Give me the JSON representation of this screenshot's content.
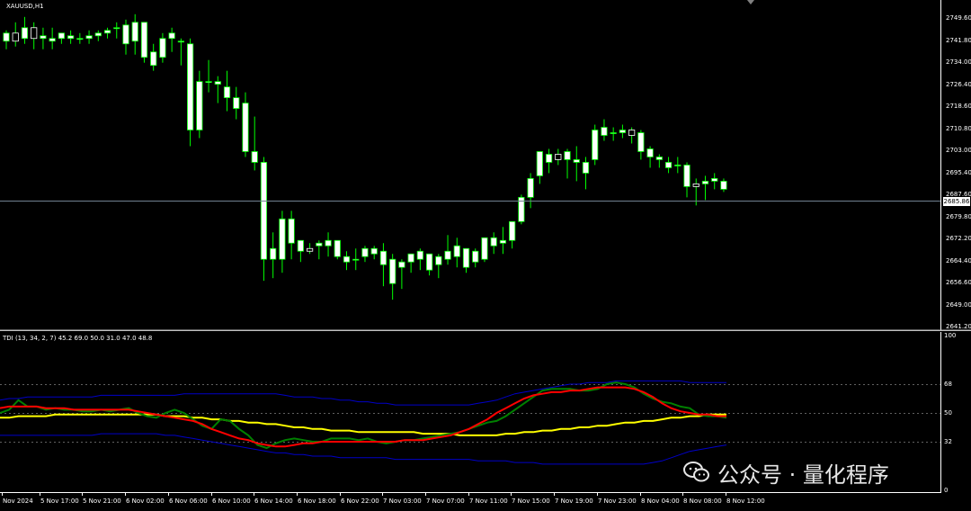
{
  "chart": {
    "symbol_title": "XAUUSD,H1",
    "indicator_title": "TDI (13, 34, 2, 7) 45.2 69.0 50.0 31.0 47.0 48.8",
    "current_price": "2685.86",
    "watermark": "公众号 · 量化程序",
    "colors": {
      "background": "#000000",
      "bull_candle": "#ffffff",
      "wick": "#00ff00",
      "price_line": "#708090",
      "rsi_line": "#008000",
      "signal_line": "#ff0000",
      "band_lines": "#0000c8",
      "base_line": "#ffff00"
    }
  },
  "price_axis": {
    "ticks": [
      "2749.60",
      "2741.80",
      "2734.00",
      "2726.40",
      "2718.60",
      "2710.80",
      "2703.00",
      "2695.40",
      "2687.60",
      "2679.80",
      "2672.20",
      "2664.40",
      "2656.60",
      "2649.00",
      "2641.20"
    ]
  },
  "tdi_axis": {
    "ticks": [
      "100",
      "68",
      "50",
      "32",
      "0"
    ]
  },
  "time_axis": {
    "ticks": [
      "Nov 2024",
      "5 Nov 17:00",
      "5 Nov 21:00",
      "6 Nov 02:00",
      "6 Nov 06:00",
      "6 Nov 10:00",
      "6 Nov 14:00",
      "6 Nov 18:00",
      "6 Nov 22:00",
      "7 Nov 03:00",
      "7 Nov 07:00",
      "7 Nov 11:00",
      "7 Nov 15:00",
      "7 Nov 19:00",
      "7 Nov 23:00",
      "8 Nov 04:00",
      "8 Nov 08:00",
      "8 Nov 12:00"
    ]
  },
  "candles": [
    [
      2741,
      2745,
      2738,
      2744
    ],
    [
      2744,
      2748,
      2739,
      2741
    ],
    [
      2742,
      2750,
      2740,
      2746
    ],
    [
      2746,
      2748,
      2738,
      2742
    ],
    [
      2742,
      2746,
      2738,
      2743
    ],
    [
      2741,
      2746,
      2738,
      2742
    ],
    [
      2742,
      2744,
      2740,
      2744
    ],
    [
      2742,
      2745,
      2740,
      2743
    ],
    [
      2742,
      2744,
      2740,
      2742
    ],
    [
      2742,
      2745,
      2740,
      2743
    ],
    [
      2743,
      2745,
      2741,
      2744
    ],
    [
      2744,
      2746,
      2742,
      2745
    ],
    [
      2746,
      2748,
      2742,
      2746
    ],
    [
      2740,
      2749,
      2736,
      2747
    ],
    [
      2741,
      2751,
      2736,
      2748
    ],
    [
      2735,
      2745,
      2733,
      2748
    ],
    [
      2732,
      2740,
      2730,
      2737
    ],
    [
      2735,
      2744,
      2733,
      2742
    ],
    [
      2742,
      2746,
      2737,
      2744
    ],
    [
      2741,
      2742,
      2732,
      2741
    ],
    [
      2708,
      2742,
      2702,
      2740
    ],
    [
      2708,
      2730,
      2705,
      2726
    ],
    [
      2726,
      2734,
      2722,
      2726
    ],
    [
      2725,
      2728,
      2718,
      2726
    ],
    [
      2720,
      2730,
      2715,
      2724
    ],
    [
      2716,
      2724,
      2712,
      2720
    ],
    [
      2700,
      2722,
      2698,
      2718
    ],
    [
      2696,
      2713,
      2693,
      2700
    ],
    [
      2660,
      2698,
      2652,
      2696
    ],
    [
      2660,
      2670,
      2653,
      2664
    ],
    [
      2660,
      2678,
      2655,
      2675
    ],
    [
      2666,
      2678,
      2660,
      2675
    ],
    [
      2663,
      2667,
      2659,
      2667
    ],
    [
      2664,
      2666,
      2662,
      2663
    ],
    [
      2665,
      2667,
      2660,
      2666
    ],
    [
      2665,
      2670,
      2661,
      2667
    ],
    [
      2661,
      2667,
      2660,
      2667
    ],
    [
      2659,
      2663,
      2656,
      2661
    ],
    [
      2660,
      2664,
      2656,
      2660
    ],
    [
      2661,
      2665,
      2659,
      2664
    ],
    [
      2662,
      2665,
      2660,
      2664
    ],
    [
      2658,
      2666,
      2650,
      2663
    ],
    [
      2651,
      2662,
      2645,
      2660
    ],
    [
      2657,
      2660,
      2649,
      2659
    ],
    [
      2659,
      2662,
      2655,
      2662
    ],
    [
      2660,
      2664,
      2656,
      2663
    ],
    [
      2656,
      2661,
      2654,
      2662
    ],
    [
      2658,
      2662,
      2653,
      2661
    ],
    [
      2660,
      2669,
      2658,
      2663
    ],
    [
      2661,
      2668,
      2657,
      2665
    ],
    [
      2657,
      2664,
      2655,
      2664
    ],
    [
      2659,
      2664,
      2657,
      2663
    ],
    [
      2660,
      2668,
      2659,
      2668
    ],
    [
      2665,
      2670,
      2662,
      2668
    ],
    [
      2666,
      2672,
      2662,
      2667
    ],
    [
      2667,
      2674,
      2664,
      2674
    ],
    [
      2674,
      2684,
      2673,
      2683
    ],
    [
      2683,
      2692,
      2679,
      2690
    ],
    [
      2691,
      2700,
      2688,
      2700
    ],
    [
      2696,
      2701,
      2692,
      2699
    ],
    [
      2699,
      2701,
      2695,
      2697
    ],
    [
      2697,
      2701,
      2690,
      2700
    ],
    [
      2696,
      2702,
      2689,
      2697
    ],
    [
      2692,
      2698,
      2686,
      2696
    ],
    [
      2697,
      2710,
      2695,
      2708
    ],
    [
      2706,
      2712,
      2704,
      2709
    ],
    [
      2707,
      2709,
      2704,
      2707
    ],
    [
      2707,
      2710,
      2705,
      2708
    ],
    [
      2708,
      2709,
      2703,
      2706
    ],
    [
      2700,
      2708,
      2697,
      2707
    ],
    [
      2698,
      2702,
      2694,
      2701
    ],
    [
      2697,
      2699,
      2694,
      2698
    ],
    [
      2694,
      2698,
      2692,
      2696
    ],
    [
      2695,
      2698,
      2692,
      2695
    ],
    [
      2687,
      2696,
      2683,
      2695
    ],
    [
      2688,
      2690,
      2680,
      2687
    ],
    [
      2688,
      2691,
      2682,
      2689
    ],
    [
      2689,
      2692,
      2686,
      2690
    ],
    [
      2686,
      2690,
      2685,
      2689
    ]
  ],
  "tdi": {
    "rsi": [
      50,
      52,
      58,
      54,
      54,
      52,
      53,
      52,
      52,
      51,
      51,
      52,
      51,
      52,
      53,
      50,
      48,
      47,
      50,
      52,
      50,
      46,
      42,
      40,
      46,
      45,
      40,
      36,
      30,
      28,
      31,
      33,
      34,
      33,
      32,
      32,
      34,
      34,
      34,
      33,
      34,
      32,
      31,
      32,
      33,
      33,
      34,
      35,
      36,
      37,
      38,
      40,
      42,
      44,
      45,
      48,
      52,
      56,
      60,
      64,
      65,
      65,
      65,
      64,
      64,
      65,
      68,
      69,
      68,
      66,
      62,
      59,
      57,
      56,
      54,
      53,
      49,
      48,
      48,
      47
    ],
    "signal": [
      53,
      54,
      54,
      54,
      54,
      53,
      53,
      53,
      52,
      52,
      52,
      52,
      52,
      52,
      52,
      51,
      50,
      49,
      48,
      47,
      46,
      45,
      43,
      40,
      38,
      36,
      34,
      33,
      31,
      30,
      29,
      29,
      30,
      31,
      31,
      32,
      32,
      32,
      32,
      32,
      32,
      32,
      32,
      32,
      33,
      33,
      33,
      34,
      35,
      36,
      38,
      40,
      43,
      46,
      50,
      53,
      56,
      59,
      61,
      62,
      63,
      63,
      64,
      64,
      65,
      66,
      66,
      66,
      66,
      65,
      63,
      60,
      56,
      53,
      51,
      50,
      49,
      49,
      48,
      48
    ],
    "base": [
      47,
      47,
      48,
      48,
      48,
      48,
      49,
      49,
      49,
      49,
      49,
      49,
      49,
      49,
      49,
      49,
      49,
      49,
      48,
      48,
      48,
      47,
      47,
      46,
      46,
      45,
      45,
      44,
      44,
      43,
      43,
      42,
      41,
      41,
      40,
      40,
      39,
      39,
      39,
      38,
      38,
      38,
      38,
      38,
      38,
      38,
      37,
      37,
      37,
      37,
      36,
      36,
      36,
      36,
      36,
      37,
      37,
      38,
      38,
      39,
      39,
      40,
      40,
      41,
      41,
      42,
      42,
      43,
      44,
      44,
      45,
      45,
      46,
      47,
      47,
      48,
      48,
      49,
      49,
      49
    ],
    "upper": [
      58,
      59,
      59,
      60,
      60,
      60,
      60,
      60,
      60,
      60,
      60,
      61,
      61,
      61,
      61,
      61,
      61,
      61,
      61,
      61,
      62,
      62,
      62,
      62,
      62,
      62,
      62,
      62,
      62,
      62,
      62,
      61,
      60,
      60,
      60,
      59,
      59,
      58,
      58,
      57,
      57,
      56,
      56,
      55,
      55,
      55,
      55,
      55,
      55,
      55,
      55,
      55,
      56,
      57,
      58,
      60,
      62,
      63,
      64,
      65,
      66,
      67,
      68,
      68,
      69,
      69,
      69,
      70,
      70,
      70,
      70,
      70,
      70,
      70,
      70,
      69,
      69,
      69,
      69,
      69
    ],
    "lower": [
      36,
      36,
      36,
      36,
      36,
      36,
      36,
      36,
      36,
      36,
      36,
      37,
      37,
      37,
      37,
      37,
      37,
      37,
      36,
      36,
      35,
      34,
      33,
      32,
      31,
      30,
      29,
      28,
      27,
      26,
      25,
      25,
      24,
      24,
      23,
      23,
      23,
      22,
      22,
      22,
      22,
      22,
      22,
      21,
      21,
      21,
      21,
      21,
      21,
      21,
      21,
      21,
      20,
      20,
      20,
      20,
      19,
      19,
      19,
      18,
      18,
      18,
      18,
      18,
      18,
      18,
      18,
      18,
      18,
      18,
      18,
      19,
      20,
      22,
      24,
      26,
      27,
      28,
      29,
      30
    ]
  }
}
